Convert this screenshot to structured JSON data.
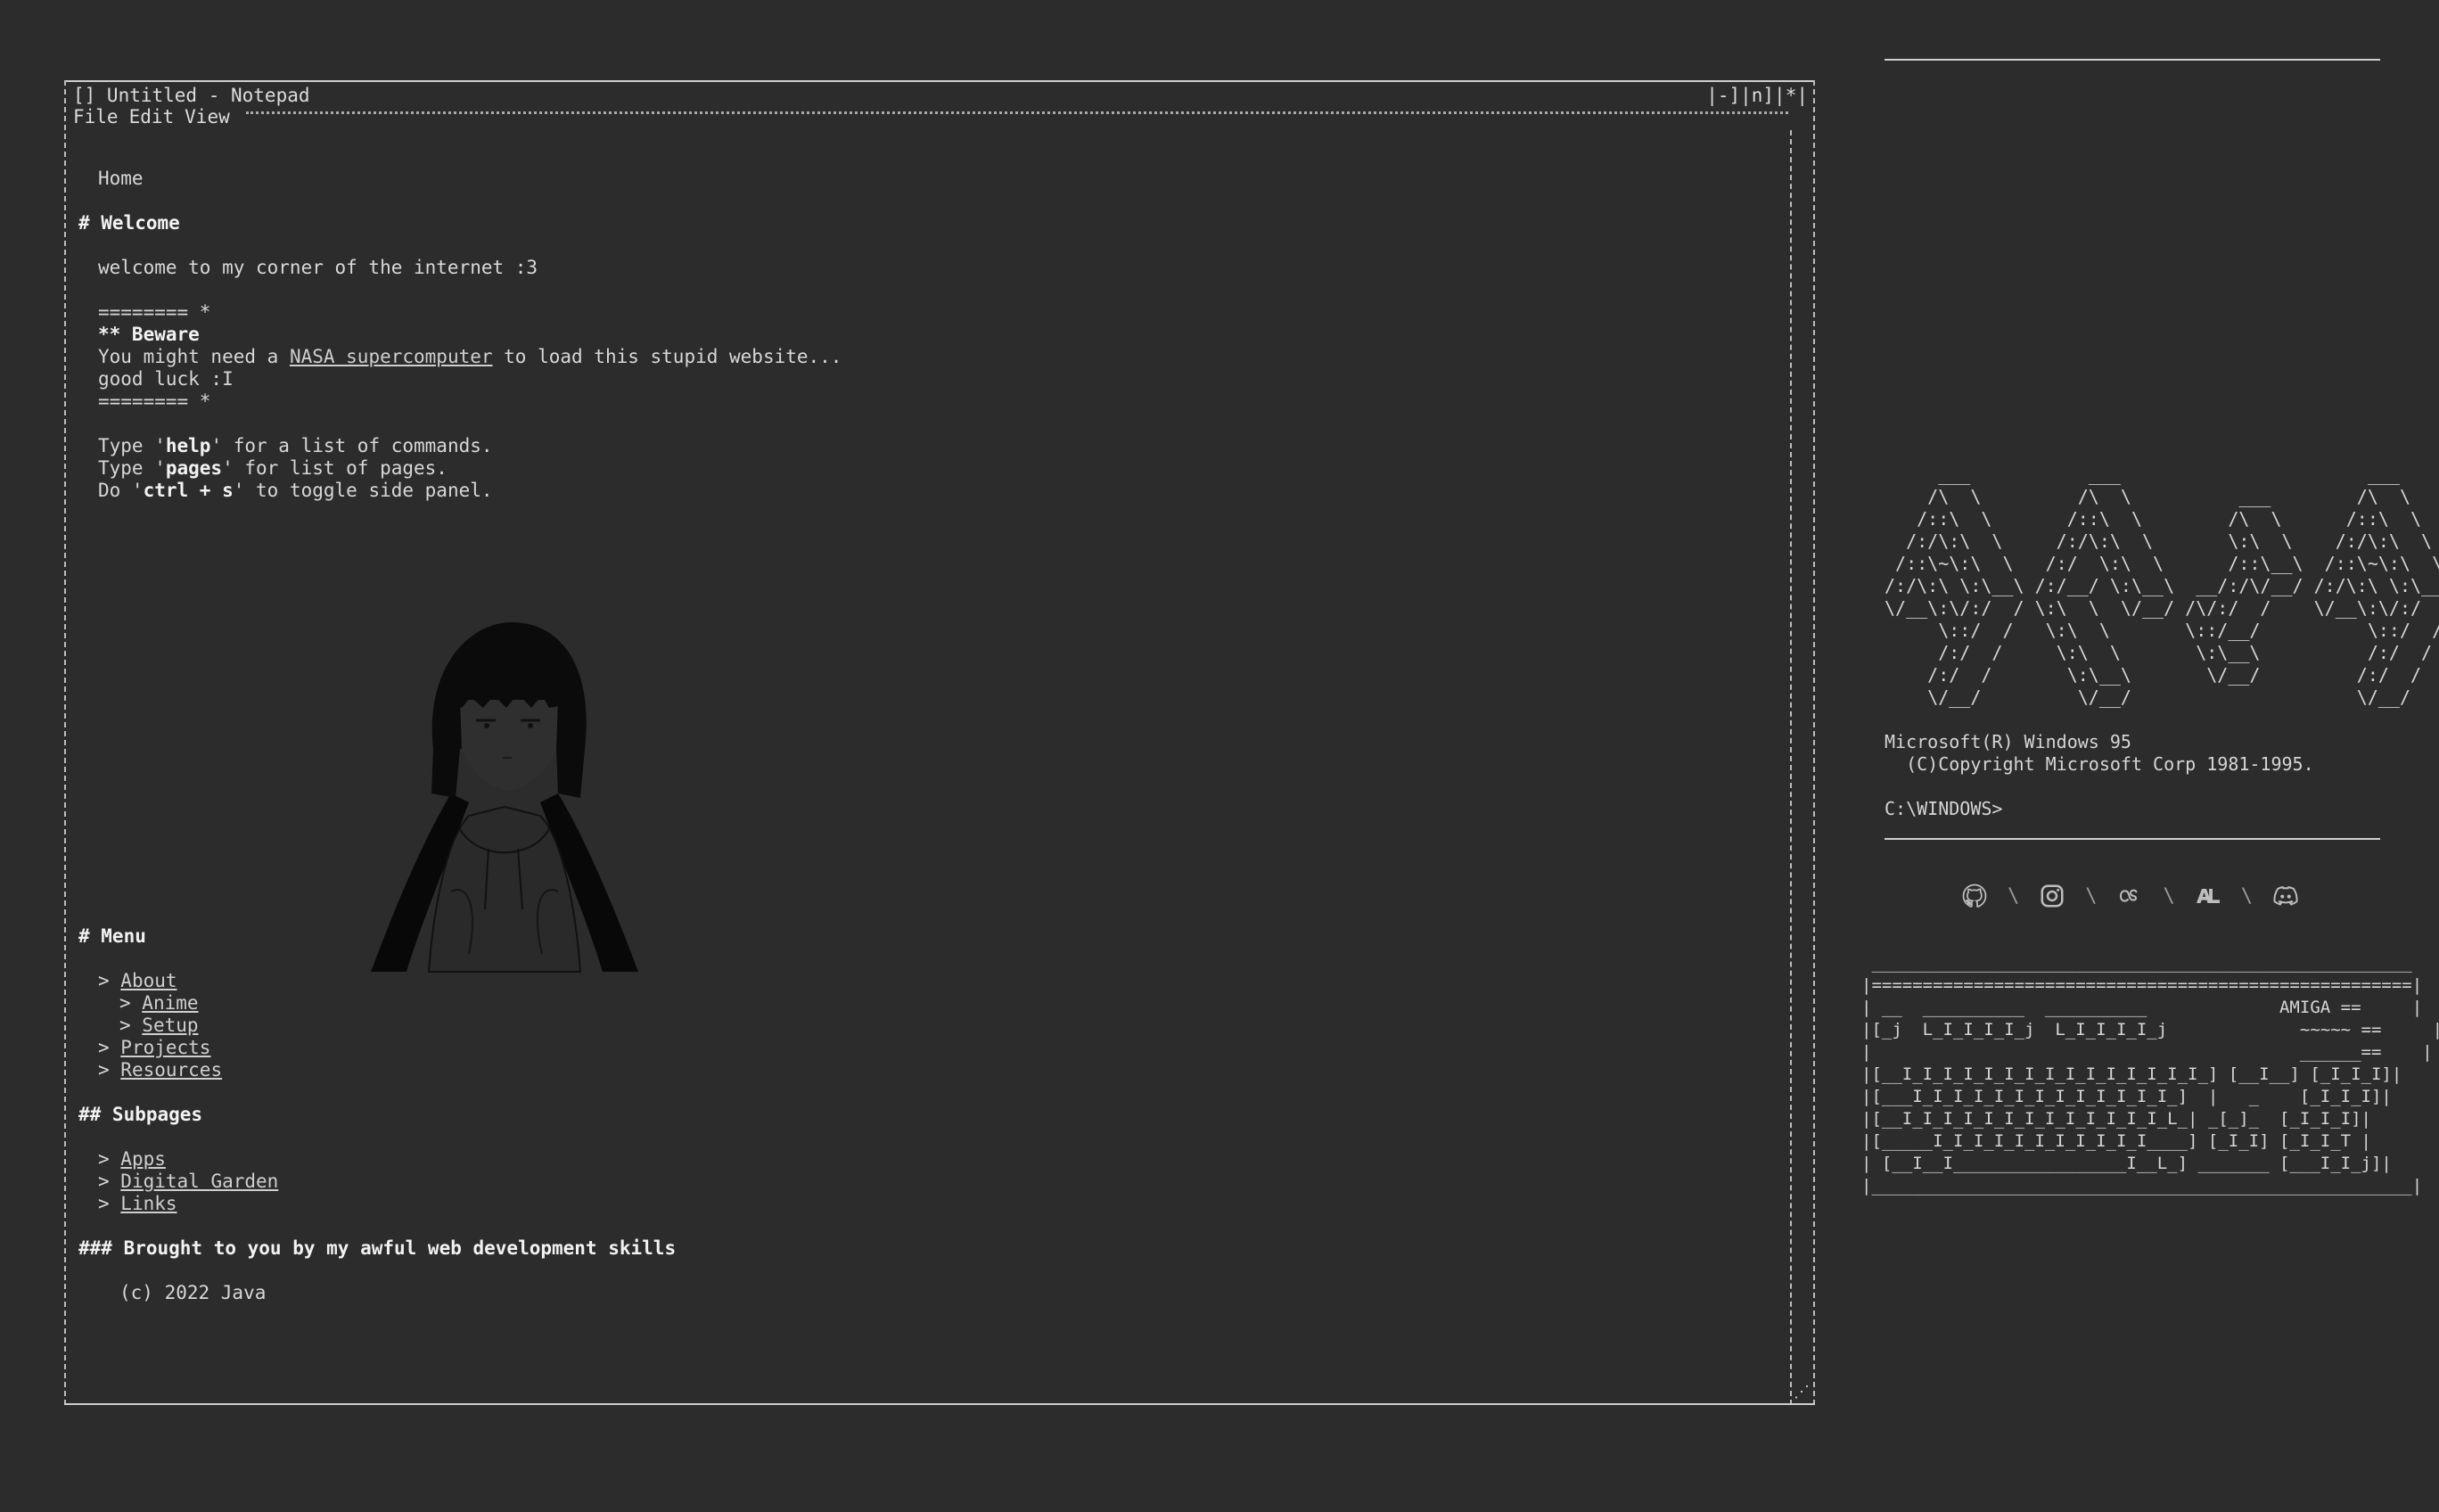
{
  "window": {
    "title": "[] Untitled - Notepad",
    "controls": "|-]|n]|*|",
    "menu": [
      "File",
      "Edit",
      "View"
    ]
  },
  "content": {
    "home": "Home",
    "welcome_heading": "# Welcome",
    "welcome_text": "welcome to my corner of the internet :3",
    "beware_rule_top": "======== *",
    "beware_heading": "** Beware",
    "beware_pre": "You might need a ",
    "beware_link": "NASA supercomputer",
    "beware_post": " to load this stupid website...",
    "good_luck": "good luck :I",
    "beware_rule_bottom": "======== *",
    "cmd1_pre": "Type '",
    "cmd1_key": "help",
    "cmd1_post": "' for a list of commands.",
    "cmd2_pre": "Type '",
    "cmd2_key": "pages",
    "cmd2_post": "' for list of pages.",
    "cmd3_pre": "Do '",
    "cmd3_key": "ctrl + s",
    "cmd3_post": "' to toggle side panel.",
    "menu_heading": "# Menu",
    "menu_items": [
      "About",
      "Anime",
      "Setup",
      "Projects",
      "Resources"
    ],
    "subpages_heading": "## Subpages",
    "subpages": [
      "Apps",
      "Digital Garden",
      "Links"
    ],
    "footer_heading": "### Brought to you by my awful web development skills",
    "copyright": "(c) 2022 Java"
  },
  "side": {
    "windows_logo": "     ___           ___                       ___     \n    /\\  \\         /\\  \\          ___        /\\  \\    \n   /::\\  \\       /::\\  \\        /\\  \\      /::\\  \\   \n  /:/\\:\\  \\     /:/\\:\\  \\       \\:\\  \\    /:/\\:\\  \\  \n /::\\~\\:\\  \\   /:/  \\:\\  \\      /::\\__\\  /::\\~\\:\\  \\ \n/:/\\:\\ \\:\\__\\ /:/__/ \\:\\__\\  __/:/\\/__/ /:/\\:\\ \\:\\__\\\n\\/__\\:\\/:/  / \\:\\  \\  \\/__/ /\\/:/  /    \\/__\\:\\/:/  /\n     \\::/  /   \\:\\  \\       \\::/__/          \\::/  / \n     /:/  /     \\:\\  \\       \\:\\__\\          /:/  /  \n    /:/  /       \\:\\__\\       \\/__/         /:/  /   \n    \\/__/         \\/__/                     \\/__/    ",
    "ms_line1": "Microsoft(R) Windows 95",
    "ms_line2": "  (C)Copyright Microsoft Corp 1981-1995.",
    "prompt": "C:\\WINDOWS>",
    "social_icons": [
      "github-icon",
      "instagram-icon",
      "lastfm-icon",
      "anilist-icon",
      "discord-icon"
    ],
    "separator": "\\",
    "amiga_art": " _____________________________________________________\n|=====================================================|\n| __  __________  __________             AMIGA ==     |\n|[_j  L_I_I_I_I_j  L_I_I_I_I_j             ~~~~~ ==     |\n|                                          ______==    |\n|[__I_I_I_I_I_I_I_I_I_I_I_I_I_I_I_] [__I__] [_I_I_I]|\n|[___I_I_I_I_I_I_I_I_I_I_I_I_I_]  |   _    [_I_I_I]|\n|[__I_I_I_I_I_I_I_I_I_I_I_I_I_L_| _[_]_  [_I_I_I]|\n|[_____I_I_I_I_I_I_I_I_I_I_I____] [_I_I] [_I_I_T |\n| [__I__I_________________I__L_] _______ [___I_I_j]|\n|_____________________________________________________|"
  }
}
